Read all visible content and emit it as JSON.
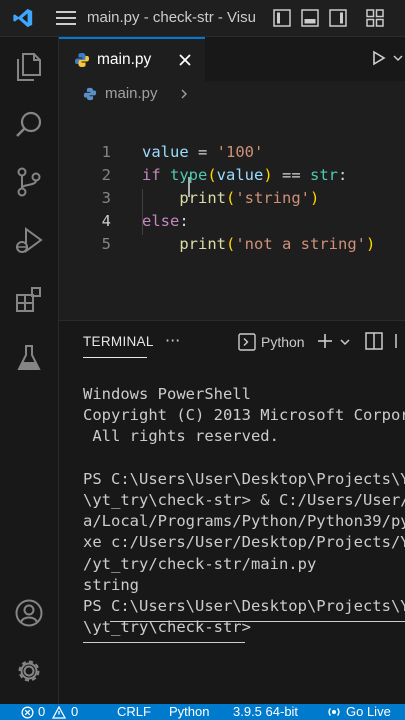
{
  "titlebar": {
    "title": "main.py - check-str - Visu"
  },
  "editor": {
    "tab_label": "main.py",
    "breadcrumb": "main.py",
    "lines": [
      {
        "n": "1",
        "parts": [
          {
            "t": "value",
            "c": "var"
          },
          {
            "t": " = ",
            "c": "op"
          },
          {
            "t": "'100'",
            "c": "str"
          }
        ]
      },
      {
        "n": "2",
        "parts": [
          {
            "t": "if ",
            "c": "kw"
          },
          {
            "t": "type",
            "c": "ty"
          },
          {
            "t": "(",
            "c": "br1"
          },
          {
            "t": "value",
            "c": "var"
          },
          {
            "t": ")",
            "c": "br1"
          },
          {
            "t": " == ",
            "c": "op"
          },
          {
            "t": "str",
            "c": "ty"
          },
          {
            "t": ":",
            "c": "op"
          }
        ]
      },
      {
        "n": "3",
        "parts": [
          {
            "t": "    ",
            "c": "op"
          },
          {
            "t": "print",
            "c": "fn"
          },
          {
            "t": "(",
            "c": "br1"
          },
          {
            "t": "'string'",
            "c": "str"
          },
          {
            "t": ")",
            "c": "br1"
          }
        ]
      },
      {
        "n": "4",
        "parts": [
          {
            "t": "else",
            "c": "kw"
          },
          {
            "t": ":",
            "c": "op"
          }
        ]
      },
      {
        "n": "5",
        "parts": [
          {
            "t": "    ",
            "c": "op"
          },
          {
            "t": "print",
            "c": "fn"
          },
          {
            "t": "(",
            "c": "br1"
          },
          {
            "t": "'not a string'",
            "c": "str"
          },
          {
            "t": ")",
            "c": "br1"
          }
        ]
      }
    ]
  },
  "panel": {
    "tab_label": "TERMINAL",
    "more_label": "···",
    "shell_label": "Python",
    "terminal_lines": [
      "Windows PowerShell",
      "Copyright (C) 2013 Microsoft Corpor",
      " All rights reserved.",
      "",
      "PS C:\\Users\\User\\Desktop\\Projects\\Y",
      "\\yt_try\\check-str> & C:/Users/User/",
      "a/Local/Programs/Python/Python39/py",
      "xe c:/Users/User/Desktop/Projects/Y",
      "/yt_try/check-str/main.py",
      "string",
      "PS C:\\Users\\User\\Desktop\\Projects\\Y",
      "\\yt_try\\check-str>"
    ]
  },
  "statusbar": {
    "problems": "0",
    "warnings": "0",
    "eol": "CRLF",
    "language": "Python",
    "interpreter": "3.9.5 64-bit",
    "golive": "Go Live"
  },
  "colors": {
    "accent": "#007acc",
    "tab_border": "#0078d4"
  }
}
